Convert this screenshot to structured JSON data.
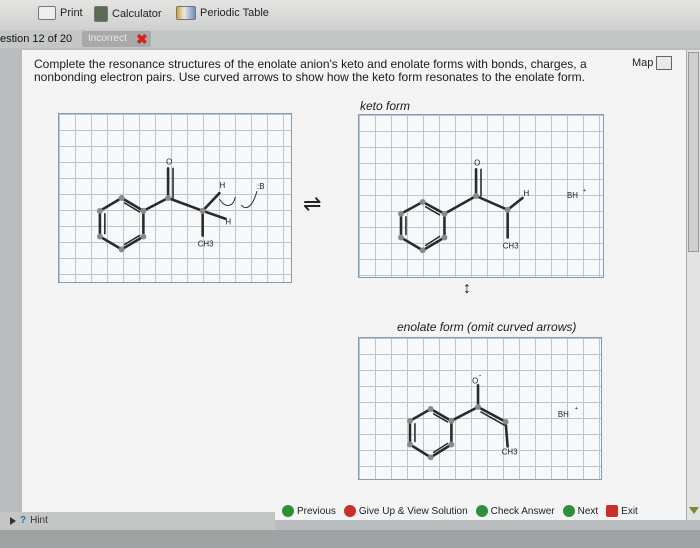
{
  "toolbar": {
    "print_label": "Print",
    "calculator_label": "Calculator",
    "periodic_table_label": "Periodic Table"
  },
  "question": {
    "number_label": "estion 12 of 20",
    "status_label": "Incorrect",
    "instructions": "Complete the resonance structures of the enolate anion's keto and enolate forms with bonds, charges, and nonbonding electron pairs. Use curved arrows to show how the keto form resonates to the enolate form.",
    "instructions_line1": "Complete the resonance structures of the enolate anion's keto and enolate forms with bonds, charges, a",
    "instructions_line2": "nonbonding electron pairs. Use curved arrows to show how the keto form resonates to the enolate form.",
    "map_label": "Map"
  },
  "keto": {
    "label": "keto form"
  },
  "enolate": {
    "label": "enolate form (omit curved arrows)"
  },
  "molecules": {
    "left": {
      "o": "O",
      "h_top": "H",
      "h_lower": "H",
      "base": ":B",
      "ch3": "CH3"
    },
    "right": {
      "o": "O",
      "h": "H",
      "bh": "BH",
      "bh_charge": "+",
      "ch3": "CH3"
    },
    "bottom": {
      "o": "O",
      "o_charge": "-",
      "bh": "BH",
      "bh_charge": "+",
      "ch3": "CH3"
    }
  },
  "symbols": {
    "equilibrium": "⇌",
    "resonance": "↕"
  },
  "actions": {
    "previous_label": "Previous",
    "give_up_label": "Give Up & View Solution",
    "check_label": "Check Answer",
    "next_label": "Next",
    "exit_label": "Exit"
  },
  "hint": {
    "label": "Hint"
  },
  "colors": {
    "incorrect": "#d0261c",
    "grid_line": "#b8c7d8",
    "check_green": "#2f8f3a",
    "give_up_red": "#c8302b"
  },
  "icons": [
    "print-icon",
    "calculator-icon",
    "periodic-table-icon",
    "map-icon",
    "previous-icon",
    "give-up-icon",
    "check-icon",
    "next-icon",
    "exit-icon",
    "hint-icon"
  ]
}
